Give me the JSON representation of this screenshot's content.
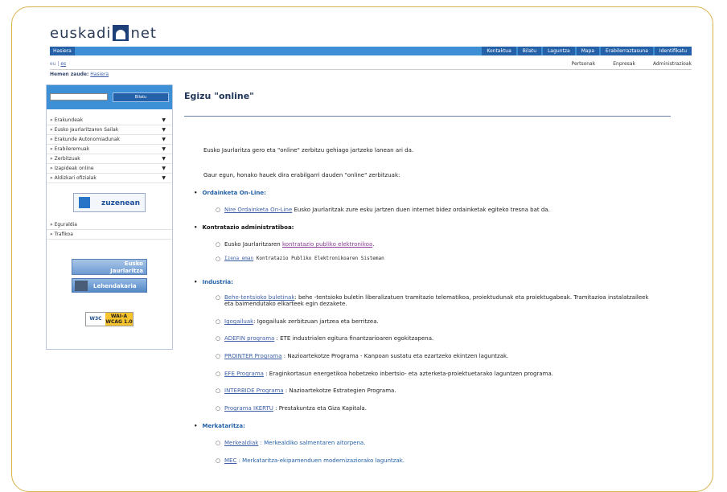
{
  "logo": {
    "left": "euskadi",
    "right": "net"
  },
  "topbar": {
    "home": "Hasiera",
    "links": [
      "Kontaktua",
      "Bilatu",
      "Laguntza",
      "Mapa",
      "Erabilerraztasuna",
      "Identifikatu"
    ]
  },
  "langbar": {
    "lang_current": "eu",
    "lang_other": "es",
    "sections": [
      "Pertsonak",
      "Enpresak",
      "Administrazioak"
    ]
  },
  "breadcrumb": {
    "label": "Hemen zaude:",
    "link": "Hasiera"
  },
  "sidebar": {
    "search_placeholder": "",
    "search_button": "Bilatu",
    "menu": [
      "Erakundeak",
      "Eusko Jaurlaritzaren Sailak",
      "Erakunde Autonomiadunak",
      "Erabileremuak",
      "Zerbitzuak",
      "Izapideak online",
      "Aldizkari ofizialak"
    ],
    "arrow": "▼",
    "zuzenean": "zuzenean",
    "menu2": [
      "Eguraldia",
      "Trafikoa"
    ],
    "banner_eusko_1": "Eusko",
    "banner_eusko_2": "Jaurlaritza",
    "banner_lehendakaria": "Lehendakaria",
    "wai_w3c": "W3C",
    "wai_level_1": "WAI-A",
    "wai_level_2": "WCAG 1.0"
  },
  "main": {
    "title": "Egizu \"online\"",
    "intro1": "Eusko Jaurlaritza gero eta \"online\" zerbitzu gehiago jartzeko lanean ari da.",
    "intro2": "Gaur egun, honako hauek dira erabilgarri dauden \"online\" zerbitzuak:",
    "ordainketa": {
      "heading": "Ordainketa On-Line:",
      "item_link": "Nire Ordainketa On-Line",
      "item_text": " Eusko Jaurlaritzak zure esku jartzen duen internet bidez ordainketak egiteko tresna bat da."
    },
    "kontratazio": {
      "heading": "Kontratazio administratiboa:",
      "item1_text": "Eusko Jaurlaritzaren ",
      "item1_link": "kontratazio publiko elektronikoa",
      "item1_end": ".",
      "item2_link": "Izena eman",
      "item2_text": " Kontratazio Publiko Elektronikoaren Sisteman"
    },
    "industria": {
      "heading": "Industria:",
      "items": [
        {
          "link": "Behe-tentsioko buletinak",
          "text": ": behe -tentsioko buletin liberalizatuen tramitazio telematikoa, proiektudunak eta proiektugabeak. Tramitazioa instalatzaileek eta baimendutako elkarteek egin dezakete."
        },
        {
          "link": "Igogailuak",
          "text": ": Igogailuak zerbitzuan jartzea eta berritzea."
        },
        {
          "link": "ADEFIN programa",
          "text": " : ETE industrialen egitura finantzarioaren egokitzapena."
        },
        {
          "link": "PROINTER Programa",
          "text": " : Nazioartekotze Programa - Kanpoan sustatu eta ezartzeko ekintzen laguntzak."
        },
        {
          "link": "EFE Programa",
          "text": " : Eraginkortasun energetikoa hobetzeko inbertsio- eta azterketa-proiektuetarako laguntzen programa."
        },
        {
          "link": "INTERBIDE Programa",
          "text": " : Nazioartekotze Estrategien Programa."
        },
        {
          "link": "Programa IKERTU",
          "text": " : Prestakuntza eta Giza Kapitala."
        }
      ]
    },
    "merkataritza": {
      "heading": "Merkataritza:",
      "items": [
        {
          "link": "Merkealdiak",
          "text": " : Merkealdiko salmentaren aitorpena."
        },
        {
          "link": "MEC",
          "text": " : Merkataritza-ekipamenduen modernizaziorako laguntzak."
        }
      ]
    }
  },
  "colors": {
    "accent": "#3d8fd6",
    "dark_accent": "#2461a8",
    "frame": "#d8b24a"
  }
}
